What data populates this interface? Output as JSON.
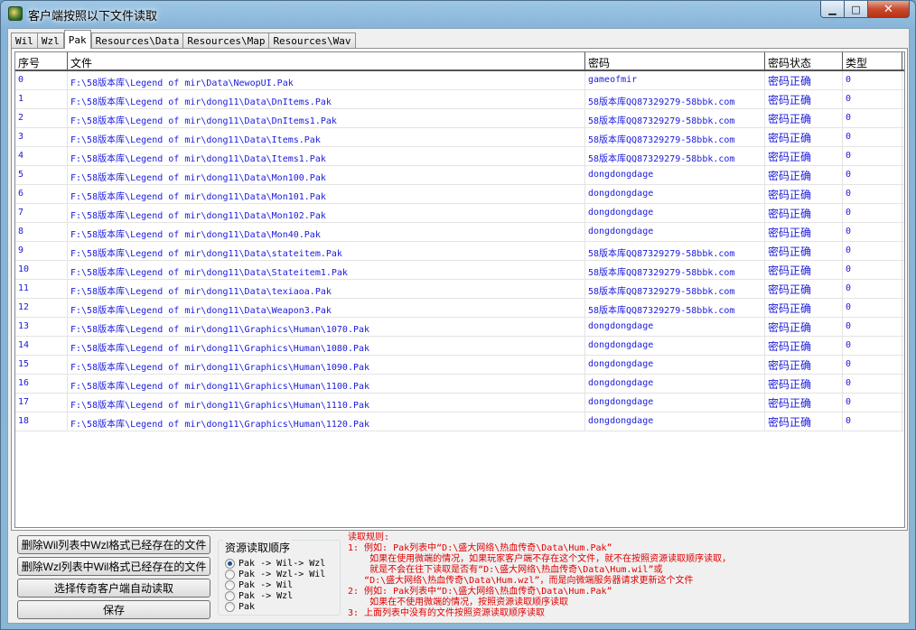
{
  "window": {
    "title": "客户端按照以下文件读取",
    "min_glyph": "▁",
    "max_glyph": "□",
    "close_glyph": "✕"
  },
  "tabs": [
    {
      "label": "Wil",
      "active": false
    },
    {
      "label": "Wzl",
      "active": false
    },
    {
      "label": "Pak",
      "active": true
    },
    {
      "label": "Resources\\Data",
      "active": false
    },
    {
      "label": "Resources\\Map",
      "active": false
    },
    {
      "label": "Resources\\Wav",
      "active": false
    }
  ],
  "table": {
    "columns": [
      "序号",
      "文件",
      "密码",
      "密码状态",
      "类型"
    ],
    "rows": [
      [
        "0",
        "F:\\58版本库\\Legend of mir\\Data\\NewopUI.Pak",
        "gameofmir",
        "密码正确",
        "0"
      ],
      [
        "1",
        "F:\\58版本库\\Legend of mir\\dong11\\Data\\DnItems.Pak",
        "58版本库QQ87329279-58bbk.com",
        "密码正确",
        "0"
      ],
      [
        "2",
        "F:\\58版本库\\Legend of mir\\dong11\\Data\\DnItems1.Pak",
        "58版本库QQ87329279-58bbk.com",
        "密码正确",
        "0"
      ],
      [
        "3",
        "F:\\58版本库\\Legend of mir\\dong11\\Data\\Items.Pak",
        "58版本库QQ87329279-58bbk.com",
        "密码正确",
        "0"
      ],
      [
        "4",
        "F:\\58版本库\\Legend of mir\\dong11\\Data\\Items1.Pak",
        "58版本库QQ87329279-58bbk.com",
        "密码正确",
        "0"
      ],
      [
        "5",
        "F:\\58版本库\\Legend of mir\\dong11\\Data\\Mon100.Pak",
        "dongdongdage",
        "密码正确",
        "0"
      ],
      [
        "6",
        "F:\\58版本库\\Legend of mir\\dong11\\Data\\Mon101.Pak",
        "dongdongdage",
        "密码正确",
        "0"
      ],
      [
        "7",
        "F:\\58版本库\\Legend of mir\\dong11\\Data\\Mon102.Pak",
        "dongdongdage",
        "密码正确",
        "0"
      ],
      [
        "8",
        "F:\\58版本库\\Legend of mir\\dong11\\Data\\Mon40.Pak",
        "dongdongdage",
        "密码正确",
        "0"
      ],
      [
        "9",
        "F:\\58版本库\\Legend of mir\\dong11\\Data\\stateitem.Pak",
        "58版本库QQ87329279-58bbk.com",
        "密码正确",
        "0"
      ],
      [
        "10",
        "F:\\58版本库\\Legend of mir\\dong11\\Data\\Stateitem1.Pak",
        "58版本库QQ87329279-58bbk.com",
        "密码正确",
        "0"
      ],
      [
        "11",
        "F:\\58版本库\\Legend of mir\\dong11\\Data\\texiaoa.Pak",
        "58版本库QQ87329279-58bbk.com",
        "密码正确",
        "0"
      ],
      [
        "12",
        "F:\\58版本库\\Legend of mir\\dong11\\Data\\Weapon3.Pak",
        "58版本库QQ87329279-58bbk.com",
        "密码正确",
        "0"
      ],
      [
        "13",
        "F:\\58版本库\\Legend of mir\\dong11\\Graphics\\Human\\1070.Pak",
        "dongdongdage",
        "密码正确",
        "0"
      ],
      [
        "14",
        "F:\\58版本库\\Legend of mir\\dong11\\Graphics\\Human\\1080.Pak",
        "dongdongdage",
        "密码正确",
        "0"
      ],
      [
        "15",
        "F:\\58版本库\\Legend of mir\\dong11\\Graphics\\Human\\1090.Pak",
        "dongdongdage",
        "密码正确",
        "0"
      ],
      [
        "16",
        "F:\\58版本库\\Legend of mir\\dong11\\Graphics\\Human\\1100.Pak",
        "dongdongdage",
        "密码正确",
        "0"
      ],
      [
        "17",
        "F:\\58版本库\\Legend of mir\\dong11\\Graphics\\Human\\1110.Pak",
        "dongdongdage",
        "密码正确",
        "0"
      ],
      [
        "18",
        "F:\\58版本库\\Legend of mir\\dong11\\Graphics\\Human\\1120.Pak",
        "dongdongdage",
        "密码正确",
        "0"
      ]
    ]
  },
  "buttons": {
    "delete_wil": "删除Wil列表中Wzl格式已经存在的文件",
    "delete_wzl": "删除Wzl列表中Wil格式已经存在的文件",
    "auto_read": "选择传奇客户端自动读取",
    "save": "保存"
  },
  "read_order": {
    "label": "资源读取顺序",
    "options": [
      {
        "label": "Pak -> Wil-> Wzl",
        "selected": true
      },
      {
        "label": "Pak -> Wzl-> Wil",
        "selected": false
      },
      {
        "label": "Pak -> Wil",
        "selected": false
      },
      {
        "label": "Pak -> Wzl",
        "selected": false
      },
      {
        "label": "Pak",
        "selected": false
      }
    ]
  },
  "rules": {
    "lines": [
      "读取规则:",
      "1: 例如: Pak列表中“D:\\盛大网络\\热血传奇\\Data\\Hum.Pak”",
      "    如果在使用微端的情况，如果玩家客户端不存在这个文件，就不在按照资源读取顺序读取，",
      "    就是不会在往下读取是否有“D:\\盛大网络\\热血传奇\\Data\\Hum.wil”或",
      "   “D:\\盛大网络\\热血传奇\\Data\\Hum.wzl”，而是向微端服务器请求更新这个文件",
      "2: 例如: Pak列表中“D:\\盛大网络\\热血传奇\\Data\\Hum.Pak”",
      "    如果在不使用微端的情况，按照资源读取顺序读取",
      "3: 上面列表中没有的文件按照资源读取顺序读取"
    ]
  }
}
